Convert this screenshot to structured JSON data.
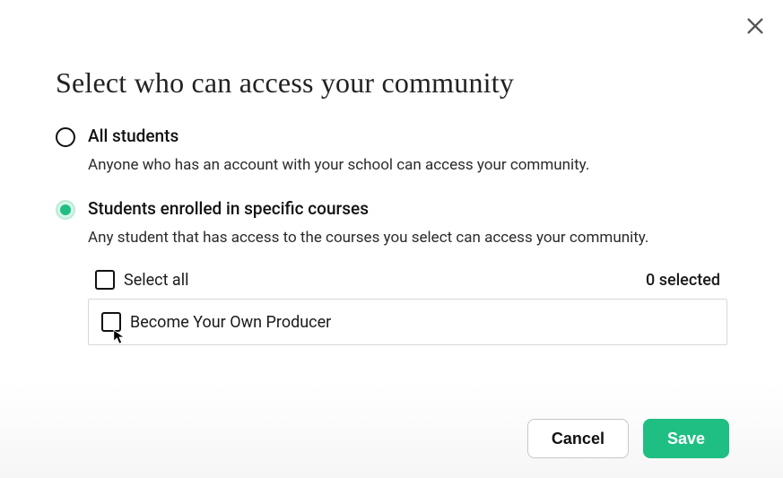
{
  "title": "Select who can access your community",
  "close_label": "Close",
  "options": {
    "all": {
      "label": "All students",
      "description": "Anyone who has an account with your school can access your community."
    },
    "specific": {
      "label": "Students enrolled in specific courses",
      "description": "Any student that has access to the courses you select can access your community."
    }
  },
  "course_picker": {
    "select_all_label": "Select all",
    "selected_count_text": "0 selected",
    "courses": [
      {
        "name": "Become Your Own Producer"
      }
    ]
  },
  "buttons": {
    "cancel": "Cancel",
    "save": "Save"
  }
}
